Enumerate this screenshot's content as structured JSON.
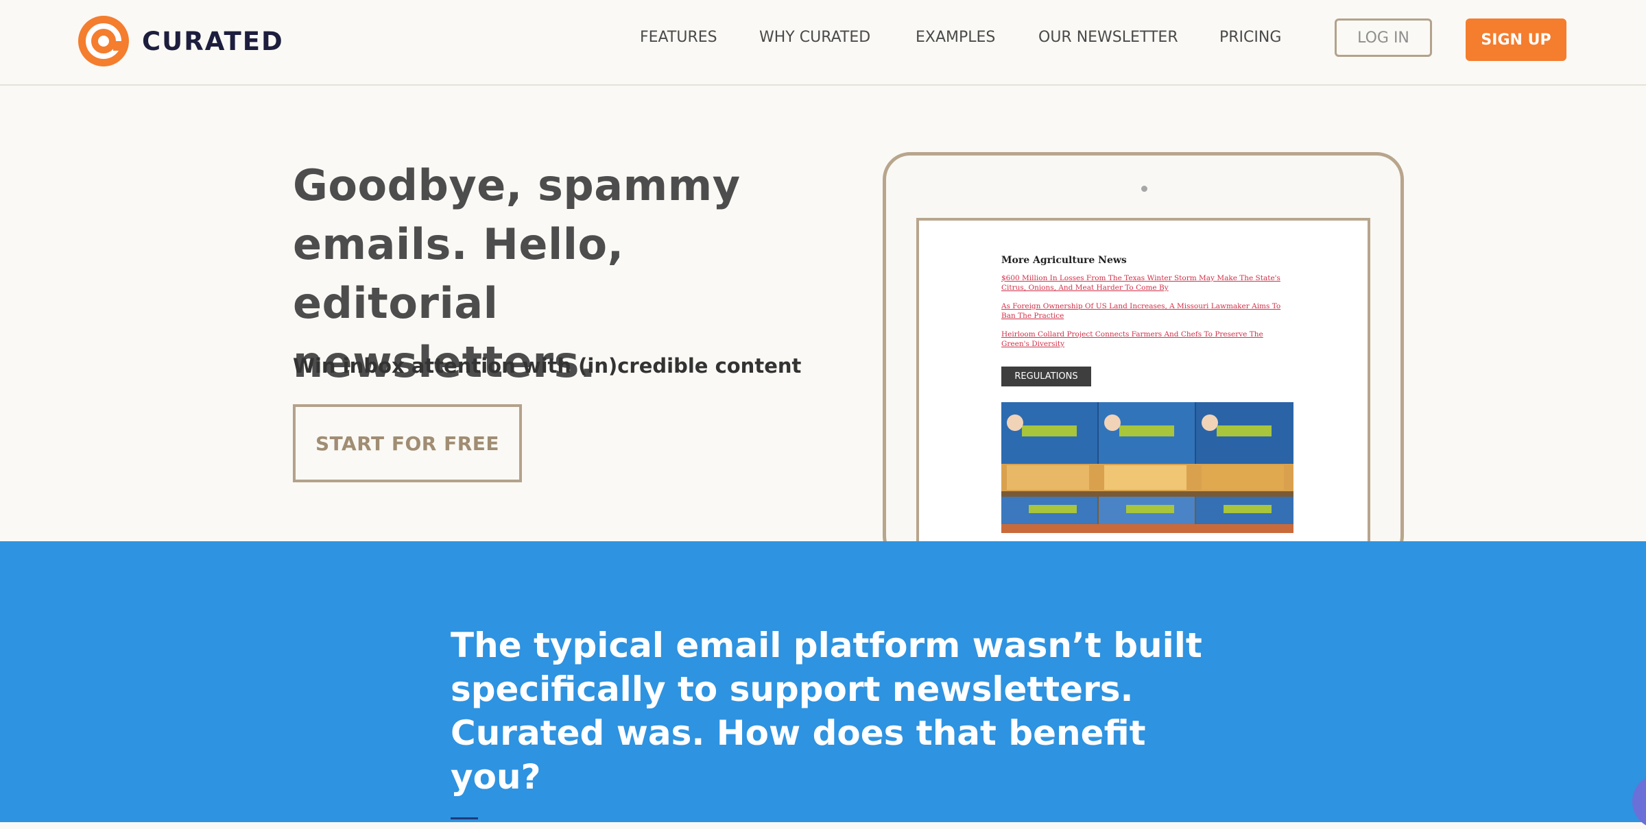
{
  "brand": {
    "name": "CURATED",
    "accent": "#f47d2e"
  },
  "nav": {
    "items": [
      {
        "label": "FEATURES"
      },
      {
        "label": "WHY CURATED"
      },
      {
        "label": "EXAMPLES"
      },
      {
        "label": "OUR NEWSLETTER"
      },
      {
        "label": "PRICING"
      }
    ],
    "login_label": "LOG IN",
    "signup_label": "SIGN UP"
  },
  "hero": {
    "title_lines": [
      "Goodbye, spammy",
      "emails. Hello, editorial",
      "newsletters."
    ],
    "subtitle": "Win inbox attention with (in)credible content",
    "cta_label": "START FOR FREE"
  },
  "preview": {
    "heading": "More Agriculture News",
    "links": [
      "$600 Million In Losses From The Texas Winter Storm May Make The State's Citrus, Onions, And Meat Harder To Come By",
      "As Foreign Ownership Of US Land Increases, A Missouri Lawmaker Aims To Ban The Practice",
      "Heirloom Collard Project Connects Farmers And Chefs To Preserve The Green's Diversity"
    ],
    "tag": "REGULATIONS",
    "photo_icon": "baby-food-jars-photo"
  },
  "band": {
    "title_lines": [
      "The typical email platform wasn’t built",
      "specifically to support newsletters.",
      "Curated was. How does that benefit you?"
    ],
    "color": "#2e93e0"
  }
}
